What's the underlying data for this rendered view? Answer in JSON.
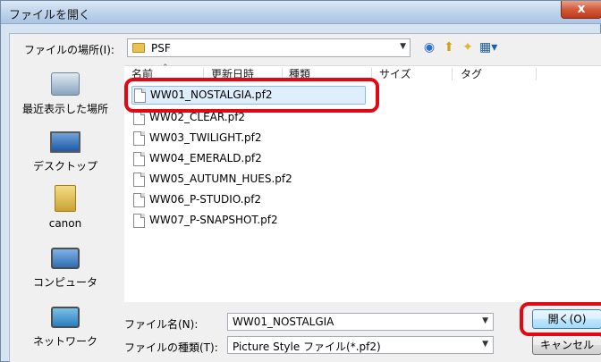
{
  "window": {
    "title": "ファイルを開く",
    "close_label": "x"
  },
  "toolbar": {
    "lookin_label": "ファイルの場所(I):",
    "lookin_value": "PSF",
    "icons": [
      "back-icon",
      "up-folder-icon",
      "new-folder-icon",
      "views-menu-icon"
    ]
  },
  "places": [
    {
      "label": "最近表示した場所",
      "icon": "recent-places-icon"
    },
    {
      "label": "デスクトップ",
      "icon": "desktop-icon"
    },
    {
      "label": "canon",
      "icon": "user-folder-icon"
    },
    {
      "label": "コンピュータ",
      "icon": "computer-icon"
    },
    {
      "label": "ネットワーク",
      "icon": "network-icon"
    }
  ],
  "columns": {
    "name": "名前",
    "date": "更新日時",
    "type": "種類",
    "size": "サイズ",
    "tag": "タグ"
  },
  "files": [
    "WW01_NOSTALGIA.pf2",
    "WW02_CLEAR.pf2",
    "WW03_TWILIGHT.pf2",
    "WW04_EMERALD.pf2",
    "WW05_AUTUMN_HUES.pf2",
    "WW06_P-STUDIO.pf2",
    "WW07_P-SNAPSHOT.pf2"
  ],
  "selected_file_index": 0,
  "filename": {
    "label": "ファイル名(N):",
    "value": "WW01_NOSTALGIA"
  },
  "filetype": {
    "label": "ファイルの種類(T):",
    "value": "Picture Style ファイル(*.pf2)"
  },
  "buttons": {
    "open": "開く(O)",
    "cancel": "キャンセル"
  },
  "colors": {
    "highlight": "#e30613",
    "selection": "#dfeefc",
    "title_gradient": "#c3d6ec"
  }
}
